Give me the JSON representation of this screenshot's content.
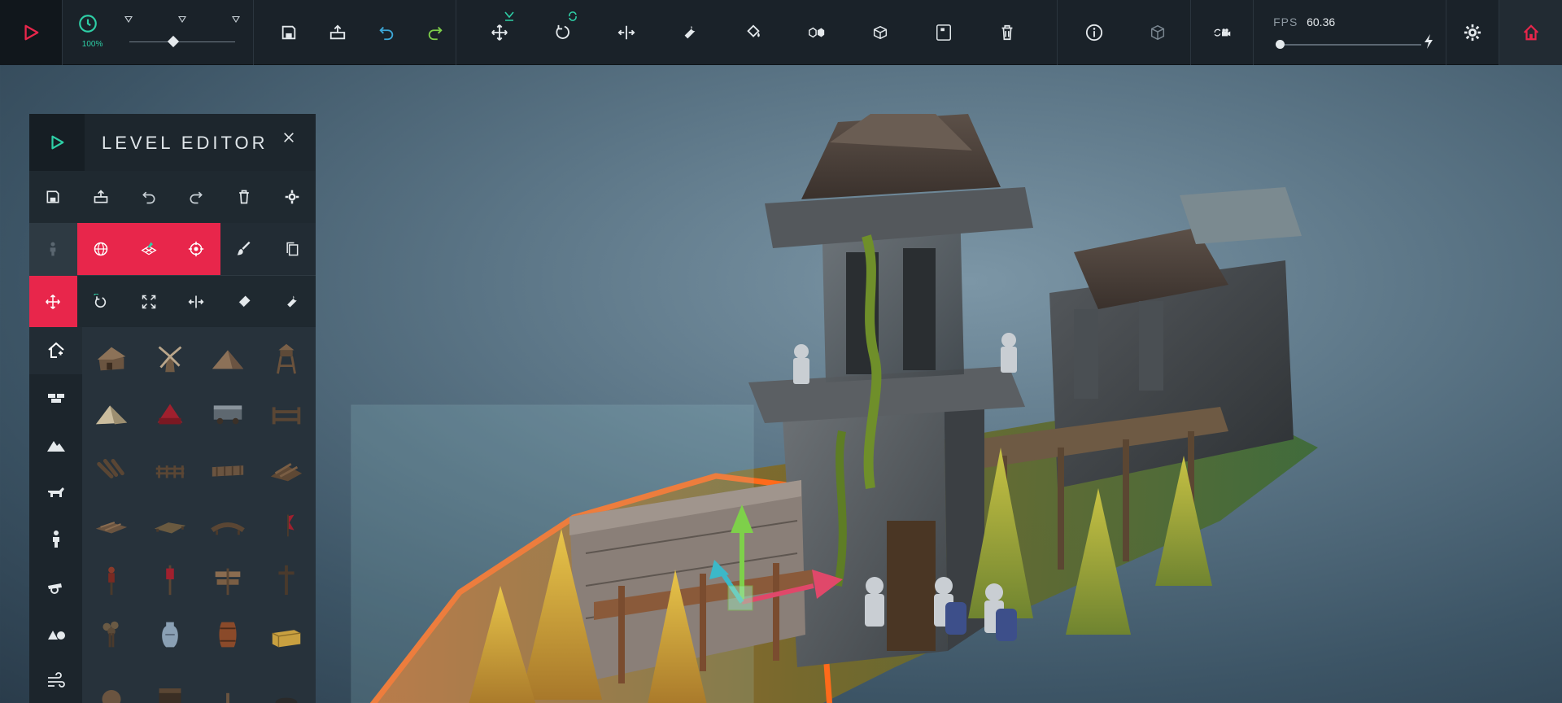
{
  "toolbar": {
    "time_scale": "100%",
    "fps_label": "FPS",
    "fps_value": "60.36",
    "time_slider": 0.42,
    "fps_slider": 0.02
  },
  "editor": {
    "title": "LEVEL EDITOR",
    "file_tools": [
      "save",
      "load",
      "undo",
      "redo",
      "delete",
      "settings"
    ],
    "mode_tools": [
      "person",
      "globe",
      "grid-placement",
      "target",
      "brush",
      "copy"
    ],
    "transform_tools": [
      "move",
      "rotate",
      "scale",
      "mirror",
      "eraser",
      "wrench"
    ],
    "categories": [
      "buildings",
      "bricks",
      "terrain",
      "animals",
      "humans",
      "weapons",
      "primitives",
      "wind"
    ],
    "items": [
      "hut",
      "windmill",
      "tent",
      "watchtower",
      "tent-white",
      "tent-red",
      "cart",
      "fence-short",
      "logs",
      "fence-long",
      "wall-panel",
      "log-pile",
      "planks-pile",
      "raft",
      "bridge",
      "flag",
      "scarecrow",
      "banner",
      "signpost",
      "cross-post",
      "tree-stump",
      "vase",
      "barrel",
      "hay-bale",
      "shield",
      "chest",
      "post",
      "rock"
    ]
  },
  "colors": {
    "accent": "#e8264b",
    "teal": "#2ecfa6",
    "panel": "#27323b",
    "toolbar": "#1a2229"
  }
}
